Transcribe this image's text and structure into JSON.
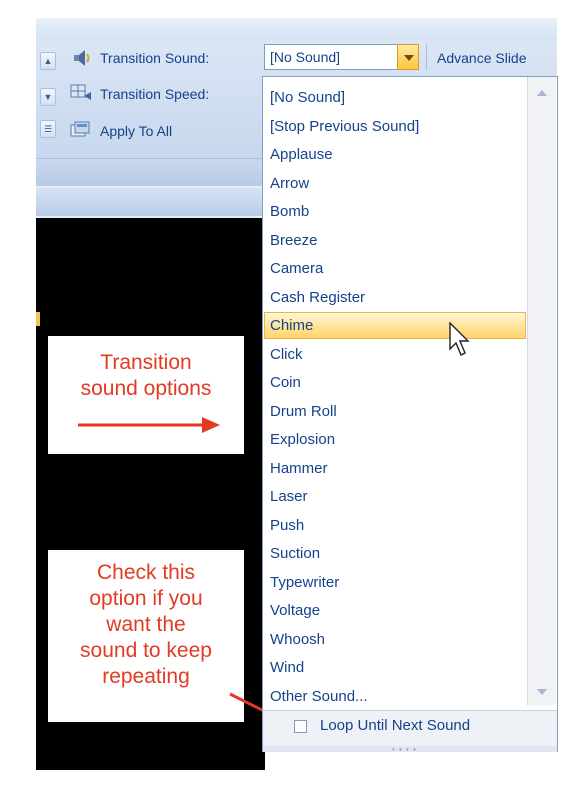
{
  "ribbon": {
    "transition_sound_label": "Transition Sound:",
    "transition_sound_value": "[No Sound]",
    "advance_slide_label": "Advance Slide",
    "transition_speed_label": "Transition Speed:",
    "apply_to_all_label": "Apply To All"
  },
  "dropdown": {
    "items": [
      "[No Sound]",
      "[Stop Previous Sound]",
      "Applause",
      "Arrow",
      "Bomb",
      "Breeze",
      "Camera",
      "Cash Register",
      "Chime",
      "Click",
      "Coin",
      "Drum Roll",
      "Explosion",
      "Hammer",
      "Laser",
      "Push",
      "Suction",
      "Typewriter",
      "Voltage",
      "Whoosh",
      "Wind",
      "Other Sound..."
    ],
    "selected": "Chime",
    "loop_label": "Loop Until Next Sound",
    "loop_checked": false
  },
  "annotations": {
    "note1": [
      "Transition",
      "sound options"
    ],
    "note2": [
      "Check this",
      "option if you",
      "want the",
      "sound to keep",
      "repeating"
    ]
  },
  "colors": {
    "annotation_text": "#e23b22",
    "ribbon_text": "#15428b",
    "selection": "#ffd36a"
  }
}
